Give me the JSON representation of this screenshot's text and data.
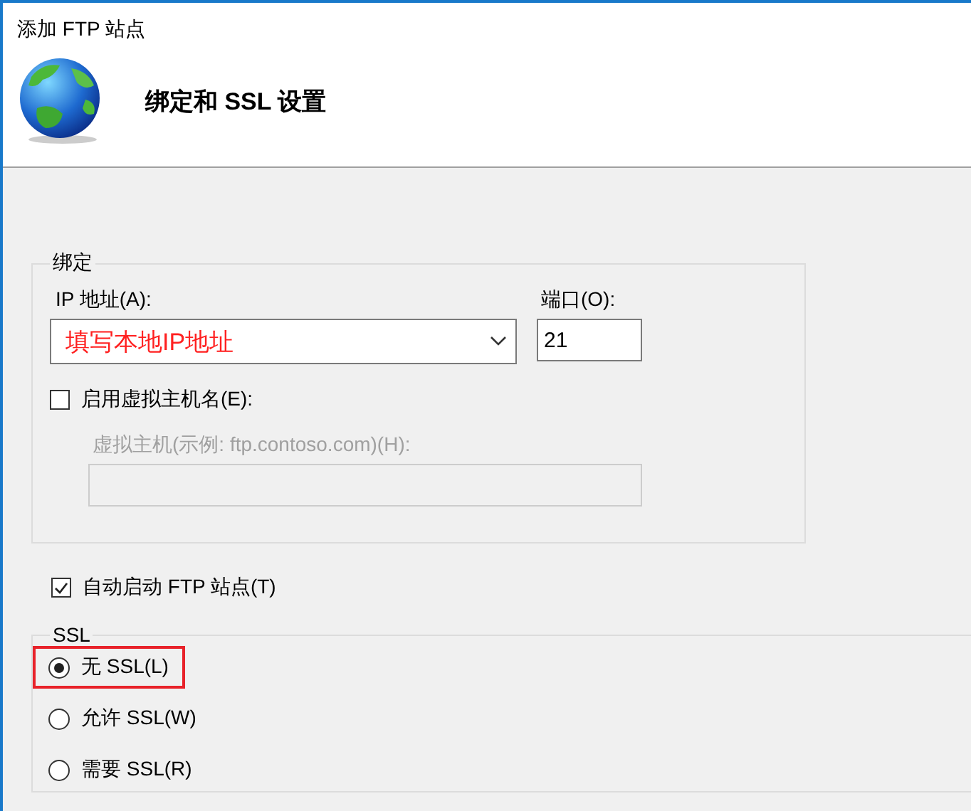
{
  "window": {
    "title": "添加 FTP 站点"
  },
  "header": {
    "title": "绑定和 SSL 设置"
  },
  "binding": {
    "legend": "绑定",
    "ip": {
      "label": "IP 地址(A):",
      "value": "填写本地IP地址"
    },
    "port": {
      "label": "端口(O):",
      "value": "21"
    },
    "virtual_host": {
      "label": "启用虚拟主机名(E):",
      "checked": false
    },
    "host_name": {
      "label": "虚拟主机(示例: ftp.contoso.com)(H):",
      "disabled": true
    }
  },
  "autostart": {
    "label": "自动启动 FTP 站点(T)",
    "checked": true
  },
  "ssl": {
    "legend": "SSL",
    "options": [
      {
        "label": "无 SSL(L)",
        "selected": true,
        "highlighted": true
      },
      {
        "label": "允许 SSL(W)",
        "selected": false,
        "highlighted": false
      },
      {
        "label": "需要 SSL(R)",
        "selected": false,
        "highlighted": false
      }
    ]
  }
}
